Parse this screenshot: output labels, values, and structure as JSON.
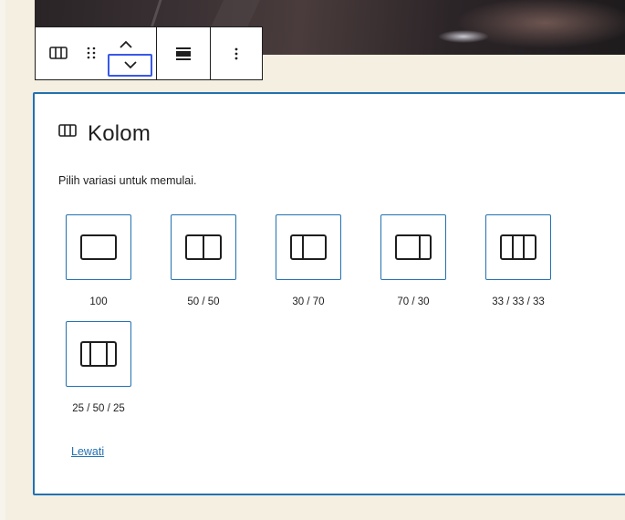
{
  "toolbar": {
    "buttons": [
      {
        "icon": "columns-icon"
      },
      {
        "icon": "drag-handle-icon"
      },
      {
        "icon": "chevron-up-icon"
      },
      {
        "icon": "chevron-down-icon"
      },
      {
        "icon": "align-icon"
      },
      {
        "icon": "more-vertical-icon"
      }
    ]
  },
  "placeholder": {
    "title": "Kolom",
    "icon": "columns-icon",
    "instructions": "Pilih variasi untuk memulai.",
    "variations": [
      {
        "label": "100",
        "icon": "one-column-icon"
      },
      {
        "label": "50 / 50",
        "icon": "two-columns-50-50-icon"
      },
      {
        "label": "30 / 70",
        "icon": "two-columns-30-70-icon"
      },
      {
        "label": "70 / 30",
        "icon": "two-columns-70-30-icon"
      },
      {
        "label": "33 / 33 / 33",
        "icon": "three-columns-equal-icon"
      },
      {
        "label": "25 / 50 / 25",
        "icon": "three-columns-wide-center-icon"
      }
    ],
    "skip_label": "Lewati"
  },
  "colors": {
    "accent": "#2271b1",
    "focus": "#3858e9",
    "canvas": "#f4efe1",
    "text": "#1e1e1e"
  }
}
